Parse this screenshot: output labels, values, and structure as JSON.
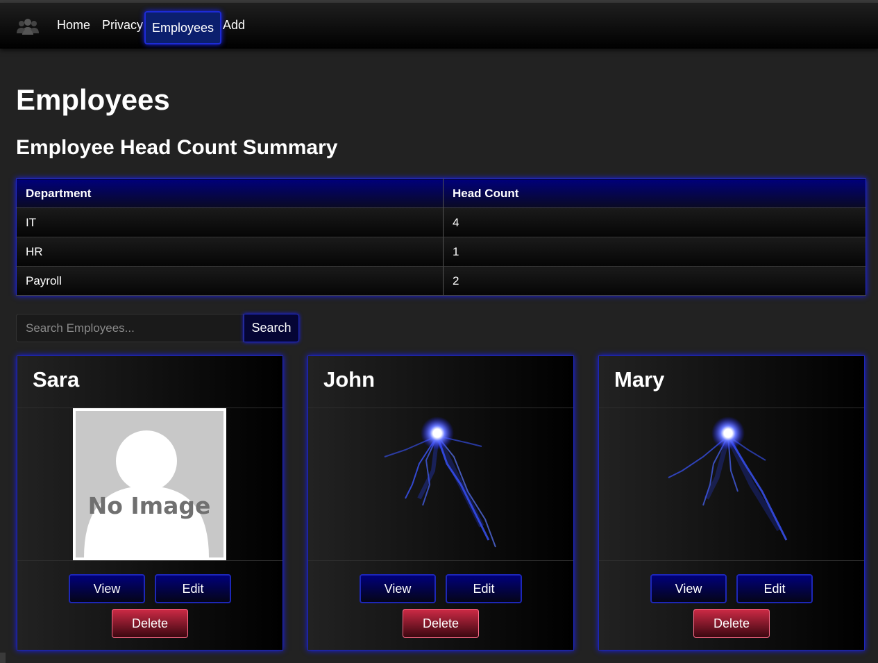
{
  "nav": {
    "logo_icon": "people-group-icon",
    "items": [
      {
        "label": "Home",
        "active": false
      },
      {
        "label": "Privacy",
        "active": false
      },
      {
        "label": "Employees",
        "active": true
      },
      {
        "label": "Add",
        "active": false
      }
    ]
  },
  "page": {
    "title": "Employees",
    "summary_title": "Employee Head Count Summary"
  },
  "summary_table": {
    "headers": [
      "Department",
      "Head Count"
    ],
    "rows": [
      [
        "IT",
        "4"
      ],
      [
        "HR",
        "1"
      ],
      [
        "Payroll",
        "2"
      ]
    ]
  },
  "search": {
    "placeholder": "Search Employees...",
    "value": "",
    "button_label": "Search"
  },
  "employees": [
    {
      "name": "Sara",
      "photo": "no-image-placeholder",
      "no_image_text": "No Image"
    },
    {
      "name": "John",
      "photo": "blue-lightning-orb"
    },
    {
      "name": "Mary",
      "photo": "blue-lightning-orb"
    }
  ],
  "card_buttons": {
    "view": "View",
    "edit": "Edit",
    "delete": "Delete"
  },
  "colors": {
    "accent_blue": "#1d27b8",
    "nav_active_bg": "#0b1f6e",
    "delete_red": "#cc2a45",
    "background": "#222222"
  }
}
